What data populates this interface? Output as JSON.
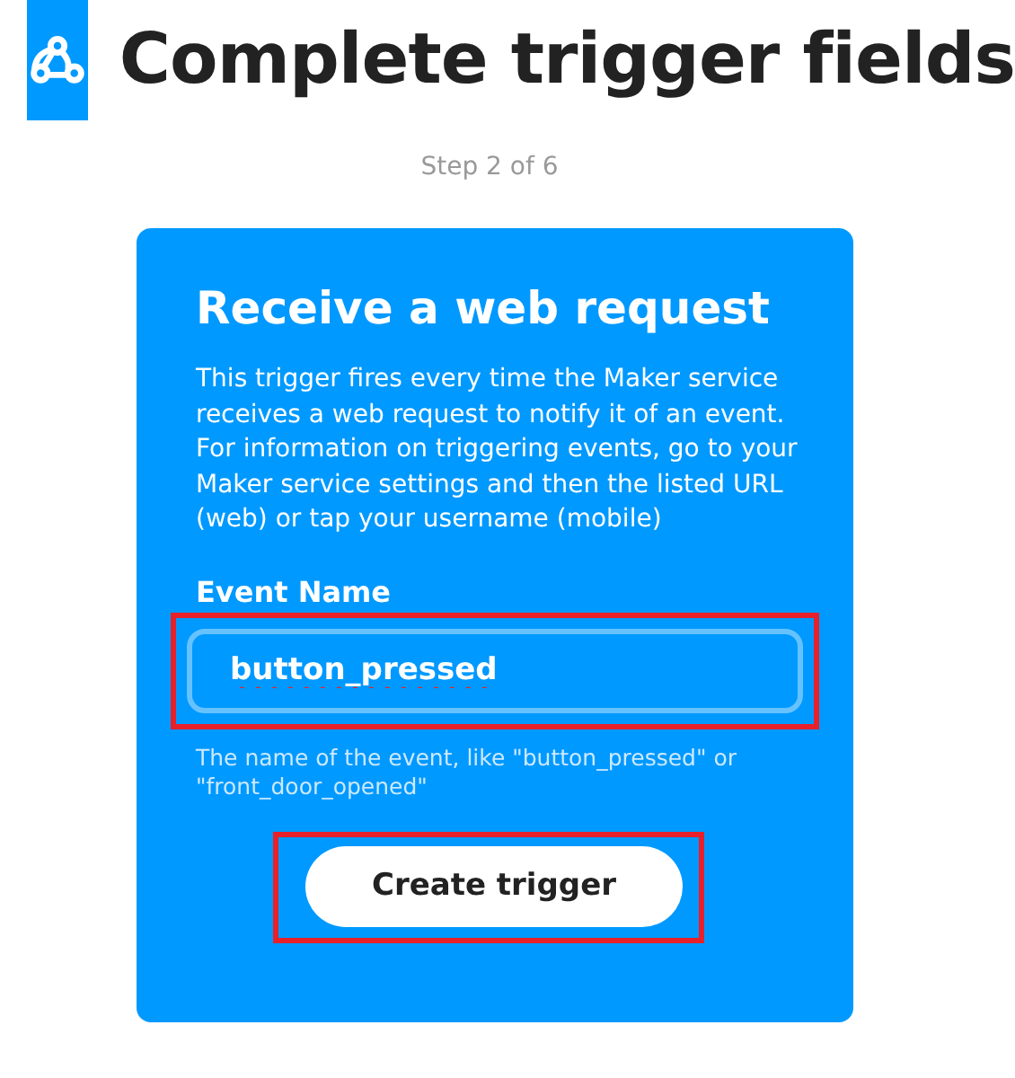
{
  "header": {
    "title": "Complete trigger fields",
    "step": "Step 2 of 6"
  },
  "card": {
    "title": "Receive a web request",
    "description": "This trigger fires every time the Maker service receives a web request to notify it of an event. For information on triggering events, go to your Maker service settings and then the listed URL (web) or tap your username (mobile)",
    "field": {
      "label": "Event Name",
      "value": "button_pressed",
      "help": "The name of the event, like \"button_pressed\" or \"front_door_opened\"",
      "highlighted": true
    },
    "button": {
      "label": "Create trigger",
      "highlighted": true
    }
  }
}
